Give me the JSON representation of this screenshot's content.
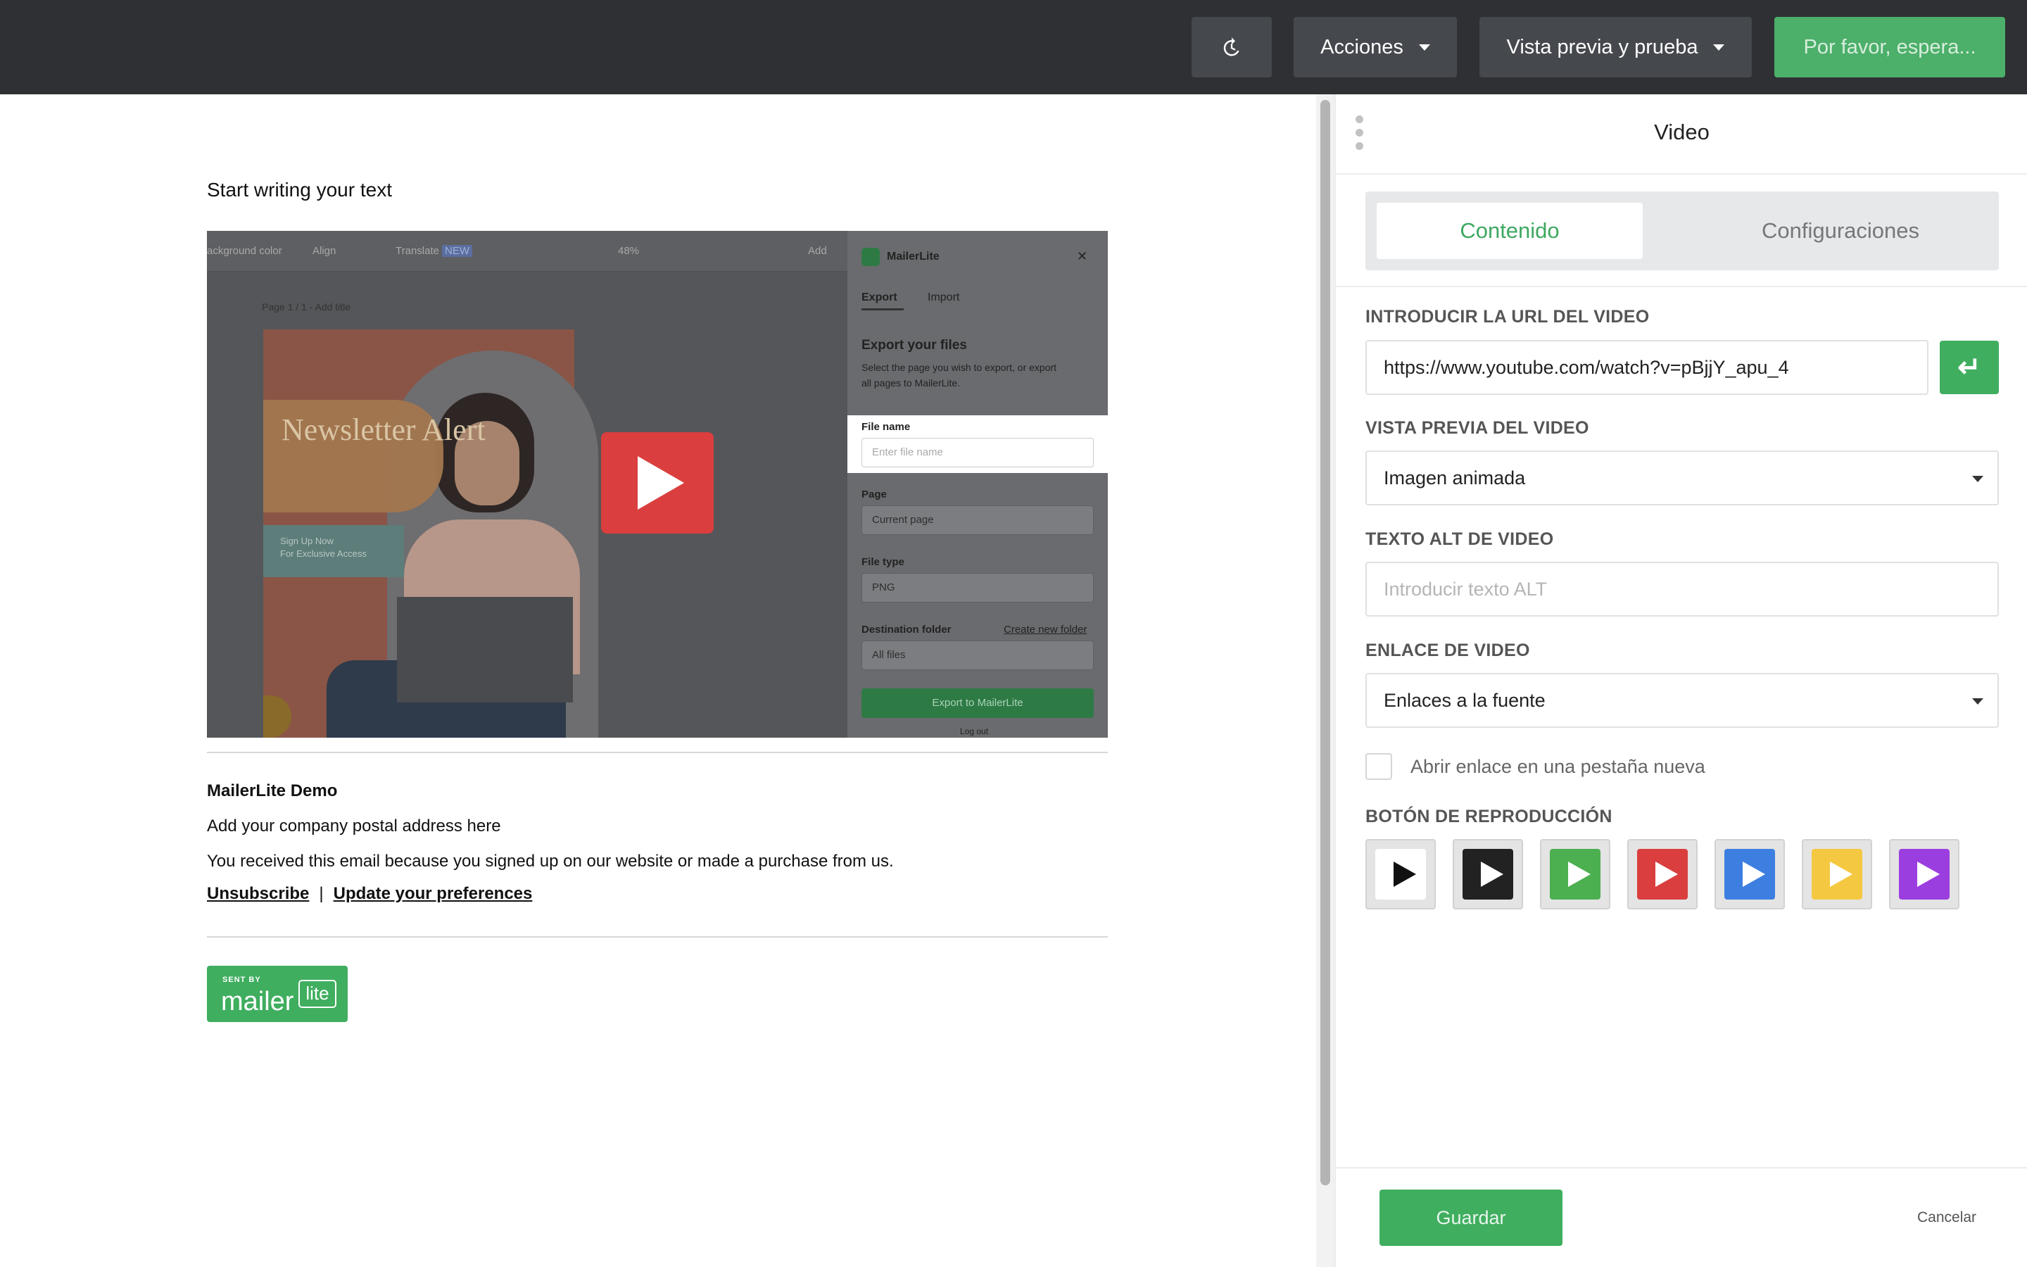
{
  "topbar": {
    "history_icon": "history-icon",
    "actions_label": "Acciones",
    "preview_label": "Vista previa y prueba",
    "wait_label": "Por favor, espera..."
  },
  "email": {
    "start_text": "Start writing your text",
    "video": {
      "toolbar": [
        "ackground color",
        "Align",
        "Translate",
        "NEW",
        "48%",
        "Add"
      ],
      "page_label": "Page 1 / 1 - Add title",
      "poster_title": "Newsletter Alert",
      "poster_signup_1": "Sign Up Now",
      "poster_signup_2": "For Exclusive Access",
      "panel": {
        "brand": "MailerLite",
        "tab_export": "Export",
        "tab_import": "Import",
        "heading": "Export your files",
        "desc_1": "Select the page you wish to export, or export",
        "desc_2": "all pages to MailerLite.",
        "file_name_label": "File name",
        "file_name_placeholder": "Enter file name",
        "page_label": "Page",
        "page_value": "Current page",
        "file_type_label": "File type",
        "file_type_value": "PNG",
        "dest_label": "Destination folder",
        "dest_link": "Create new folder",
        "dest_value": "All files",
        "export_button": "Export to MailerLite",
        "logout": "Log out"
      }
    },
    "footer": {
      "company": "MailerLite Demo",
      "address": "Add your company postal address here",
      "received": "You received this email because you signed up on our website or made a purchase from us.",
      "unsubscribe": "Unsubscribe",
      "separator": "|",
      "preferences": "Update your preferences"
    },
    "badge": {
      "sent_by": "SENT BY",
      "mailer": "mailer",
      "lite": "lite"
    }
  },
  "panel": {
    "title": "Video",
    "tab_content": "Contenido",
    "tab_settings": "Configuraciones",
    "url_label": "INTRODUCIR LA URL DEL VIDEO",
    "url_value": "https://www.youtube.com/watch?v=pBjjY_apu_4",
    "enter_symbol": "↵",
    "preview_label": "VISTA PREVIA DEL VIDEO",
    "preview_value": "Imagen animada",
    "alt_label": "TEXTO ALT DE VIDEO",
    "alt_placeholder": "Introducir texto ALT",
    "link_label": "ENLACE DE VIDEO",
    "link_value": "Enlaces a la fuente",
    "new_tab_label": "Abrir enlace en una pestaña nueva",
    "play_label": "BOTÓN DE REPRODUCCIÓN",
    "play_options": [
      {
        "bg": "#ffffff",
        "tri": "#111111"
      },
      {
        "bg": "#222222",
        "tri": "#ffffff"
      },
      {
        "bg": "#4caf50",
        "tri": "#ffffff"
      },
      {
        "bg": "#da3e3e",
        "tri": "#ffffff"
      },
      {
        "bg": "#3d7fe0",
        "tri": "#ffffff"
      },
      {
        "bg": "#f5c842",
        "tri": "#ffffff"
      },
      {
        "bg": "#9b3ee0",
        "tri": "#ffffff"
      }
    ],
    "save_label": "Guardar",
    "cancel_label": "Cancelar"
  },
  "colors": {
    "topbar": "#2e3033",
    "accent_green": "#3fae5f",
    "play_red": "#da3e3e"
  }
}
